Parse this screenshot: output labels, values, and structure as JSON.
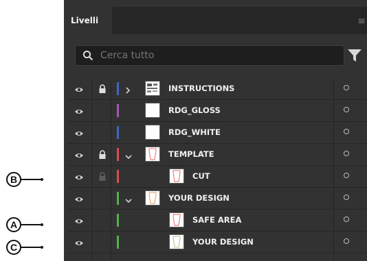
{
  "panel": {
    "tab_label": "Livelli",
    "search_placeholder": "Cerca tutto"
  },
  "colors": {
    "blue": "#3f66c6",
    "purple": "#a455b4",
    "red": "#e04b4b",
    "green": "#4fb34a"
  },
  "layers": [
    {
      "name": "INSTRUCTIONS",
      "color": "#3f66c6",
      "lock": "locked",
      "chevron": "right",
      "indent": 0,
      "thumb": "instructions"
    },
    {
      "name": "RDG_GLOSS",
      "color": "#a455b4",
      "lock": "none",
      "chevron": "none",
      "indent": 0,
      "thumb": "blank"
    },
    {
      "name": "RDG_WHITE",
      "color": "#3f66c6",
      "lock": "none",
      "chevron": "none",
      "indent": 0,
      "thumb": "blank"
    },
    {
      "name": "TEMPLATE",
      "color": "#e04b4b",
      "lock": "locked",
      "chevron": "down",
      "indent": 0,
      "thumb": "shape-red"
    },
    {
      "name": "CUT",
      "color": "#e04b4b",
      "lock": "dimmed",
      "chevron": "none",
      "indent": 1,
      "thumb": "shape-red"
    },
    {
      "name": "YOUR DESIGN",
      "color": "#4fb34a",
      "lock": "none",
      "chevron": "down",
      "indent": 0,
      "thumb": "shape-orange"
    },
    {
      "name": "SAFE AREA",
      "color": "#4fb34a",
      "lock": "none",
      "chevron": "none",
      "indent": 1,
      "thumb": "shape-red"
    },
    {
      "name": "YOUR DESIGN",
      "color": "#4fb34a",
      "lock": "none",
      "chevron": "none",
      "indent": 1,
      "thumb": "shape-green"
    }
  ],
  "callouts": [
    {
      "label": "B",
      "row": 4
    },
    {
      "label": "A",
      "row": 6
    },
    {
      "label": "C",
      "row": 7
    }
  ]
}
